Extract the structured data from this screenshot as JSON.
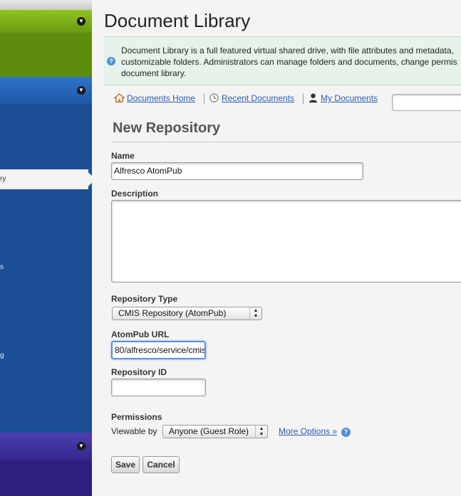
{
  "sidebar": {
    "selected_item": "ry",
    "items": [
      "s",
      "g"
    ]
  },
  "main": {
    "title": "Document Library",
    "info_lines": [
      "Document Library is a full featured virtual shared drive, with file attributes and metadata,",
      "customizable folders. Administrators can manage folders and documents, change permis",
      "document library."
    ],
    "nav": {
      "documents_home": "Documents Home",
      "recent_documents": "Recent Documents",
      "my_documents": "My Documents"
    },
    "form": {
      "title": "New Repository",
      "name_label": "Name",
      "name_value": "Alfresco AtomPub",
      "description_label": "Description",
      "description_value": "",
      "repo_type_label": "Repository Type",
      "repo_type_value": "CMIS Repository (AtomPub)",
      "atompub_label": "AtomPub URL",
      "atompub_value": "80/alfresco/service/cmis",
      "repo_id_label": "Repository ID",
      "repo_id_value": "",
      "permissions_label": "Permissions",
      "viewable_by_label": "Viewable by",
      "viewable_by_value": "Anyone (Guest Role)",
      "more_options": "More Options »",
      "save": "Save",
      "cancel": "Cancel"
    }
  },
  "icons": [
    "collapse-icon",
    "home-icon",
    "clock-icon",
    "user-icon",
    "info-icon",
    "help-icon"
  ],
  "colors": {
    "link": "#2a5db0",
    "info_bg": "#e5f3ea",
    "sidebar_green": "#8fc31f",
    "sidebar_blue": "#1c4f96",
    "sidebar_purple": "#35278e"
  }
}
